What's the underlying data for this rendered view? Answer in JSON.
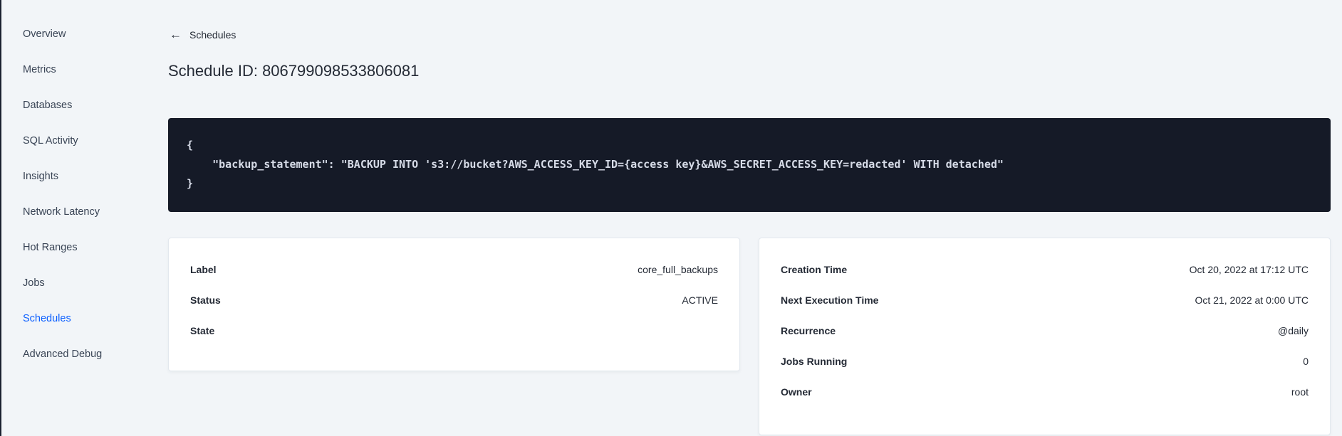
{
  "colors": {
    "page_bg": "#f2f5f8",
    "accent_blue": "#0b5fff",
    "code_bg": "#151a27",
    "code_text": "#d6dbe7",
    "text_dark": "#242a35"
  },
  "sidebar": {
    "items": [
      {
        "label": "Overview",
        "active": false
      },
      {
        "label": "Metrics",
        "active": false
      },
      {
        "label": "Databases",
        "active": false
      },
      {
        "label": "SQL Activity",
        "active": false
      },
      {
        "label": "Insights",
        "active": false
      },
      {
        "label": "Network Latency",
        "active": false
      },
      {
        "label": "Hot Ranges",
        "active": false
      },
      {
        "label": "Jobs",
        "active": false
      },
      {
        "label": "Schedules",
        "active": true
      },
      {
        "label": "Advanced Debug",
        "active": false
      }
    ]
  },
  "header": {
    "back_icon": "left-arrow",
    "back_label": "Schedules",
    "page_title": "Schedule ID: 806799098533806081"
  },
  "code_block": {
    "lines": [
      "{",
      "    \"backup_statement\": \"BACKUP INTO 's3://bucket?AWS_ACCESS_KEY_ID={access key}&AWS_SECRET_ACCESS_KEY=redacted' WITH detached\"",
      "}"
    ]
  },
  "details_left": {
    "rows": [
      {
        "label": "Label",
        "value": "core_full_backups"
      },
      {
        "label": "Status",
        "value": "ACTIVE"
      },
      {
        "label": "State",
        "value": ""
      }
    ]
  },
  "details_right": {
    "rows": [
      {
        "label": "Creation Time",
        "value": "Oct 20, 2022 at 17:12 UTC"
      },
      {
        "label": "Next Execution Time",
        "value": "Oct 21, 2022 at 0:00 UTC"
      },
      {
        "label": "Recurrence",
        "value": "@daily"
      },
      {
        "label": "Jobs Running",
        "value": "0"
      },
      {
        "label": "Owner",
        "value": "root"
      }
    ]
  }
}
